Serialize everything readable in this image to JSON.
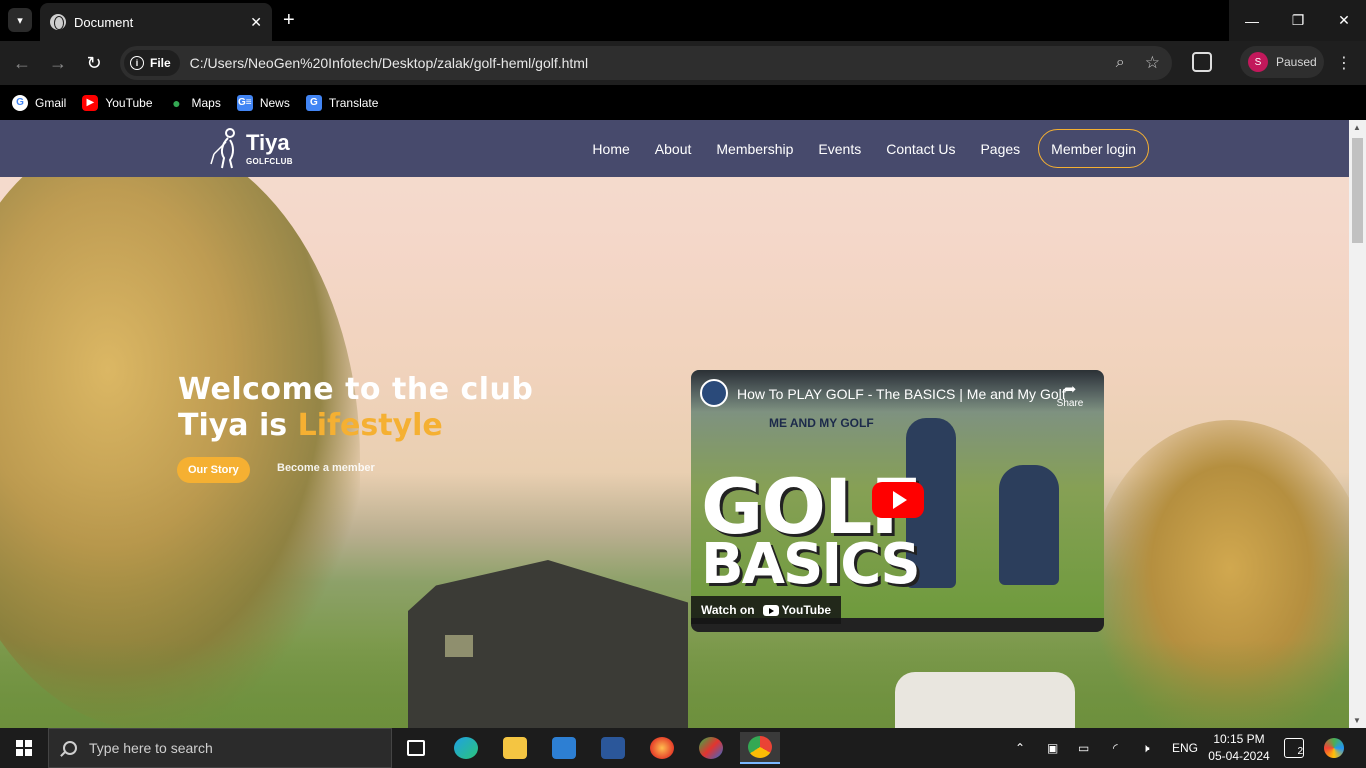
{
  "browser": {
    "tab_title": "Document",
    "file_chip": "File",
    "url": "C:/Users/NeoGen%20Infotech/Desktop/zalak/golf-heml/golf.html",
    "profile_initial": "S",
    "profile_status": "Paused",
    "bookmarks": [
      {
        "label": "Gmail",
        "icon": "G"
      },
      {
        "label": "YouTube",
        "icon": "▶"
      },
      {
        "label": "Maps",
        "icon": "●"
      },
      {
        "label": "News",
        "icon": "G≡"
      },
      {
        "label": "Translate",
        "icon": "G"
      }
    ]
  },
  "site": {
    "logo_name": "Tiya",
    "logo_sub": "GOLFCLUB",
    "nav": [
      "Home",
      "About",
      "Membership",
      "Events",
      "Contact Us",
      "Pages"
    ],
    "login": "Member login",
    "hero": {
      "line1": "Welcome to the club",
      "line2_prefix": "Tiya is ",
      "line2_accent": "Lifestyle",
      "btn_primary": "Our Story",
      "btn_secondary": "Become a member"
    },
    "video": {
      "title": "How To PLAY GOLF - The BASICS | Me and My Golf",
      "share": "Share",
      "overlay_big": "GOLF",
      "overlay_sub": "BASICS",
      "brand": "ME AND MY GOLF",
      "watch_on": "Watch on",
      "youtube": "YouTube"
    }
  },
  "taskbar": {
    "search_placeholder": "Type here to search",
    "language": "ENG",
    "time": "10:15 PM",
    "date": "05-04-2024",
    "notifications": "2"
  },
  "colors": {
    "header_bg": "#474a6c",
    "accent": "#f5b032"
  }
}
